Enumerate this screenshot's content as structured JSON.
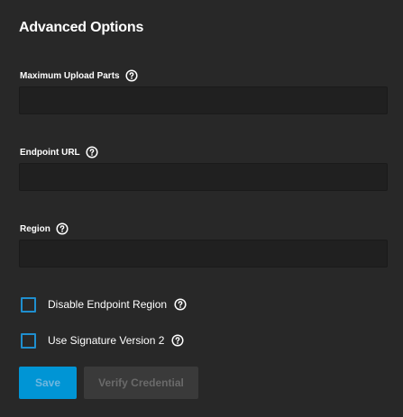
{
  "section": {
    "title": "Advanced Options"
  },
  "fields": {
    "max_upload_parts": {
      "label": "Maximum Upload Parts",
      "value": "",
      "placeholder": ""
    },
    "endpoint_url": {
      "label": "Endpoint URL",
      "value": "",
      "placeholder": ""
    },
    "region": {
      "label": "Region",
      "value": "",
      "placeholder": ""
    }
  },
  "checkboxes": {
    "disable_endpoint_region": {
      "label": "Disable Endpoint Region",
      "checked": false
    },
    "use_signature_v2": {
      "label": "Use Signature Version 2",
      "checked": false
    }
  },
  "actions": {
    "save_label": "Save",
    "verify_label": "Verify Credential",
    "save_enabled": false,
    "verify_enabled": false
  },
  "colors": {
    "background": "#282828",
    "input_background": "#202020",
    "accent": "#0095d5",
    "checkbox_border": "#1f8fcf",
    "disabled_button": "#3a3a3a"
  },
  "icons": {
    "help": "help-circle-icon"
  }
}
